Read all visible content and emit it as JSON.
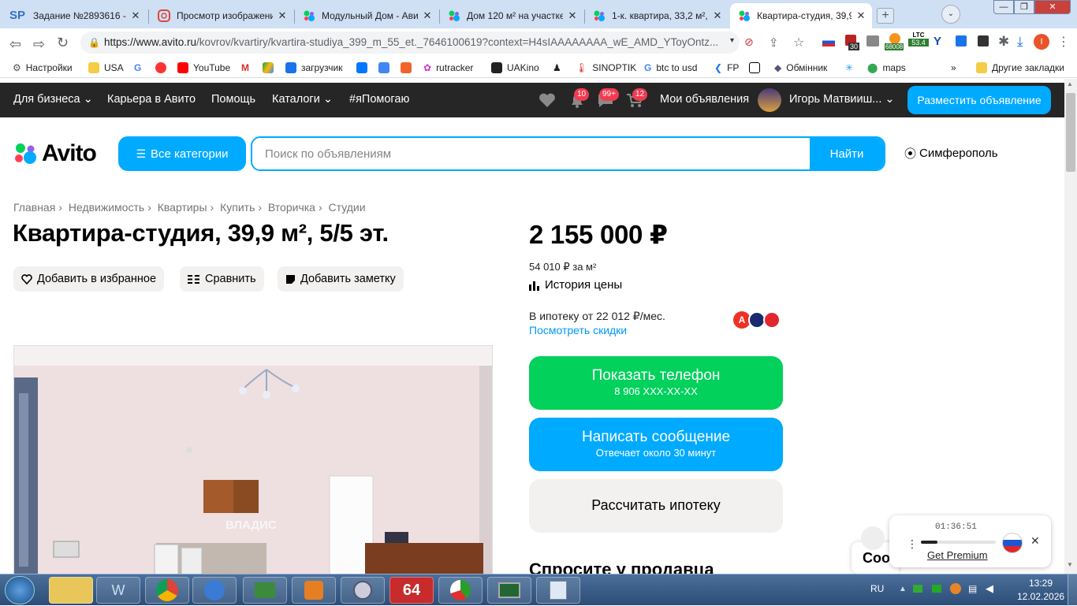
{
  "browser": {
    "tabs": [
      {
        "title": "Задание №2893616 - п",
        "favicon": "sp-icon"
      },
      {
        "title": "Просмотр изображени",
        "favicon": "image-viewer-icon"
      },
      {
        "title": "Модульный Дом - Ави",
        "favicon": "avito-icon"
      },
      {
        "title": "Дом 120 м² на участке",
        "favicon": "avito-icon"
      },
      {
        "title": "1-к. квартира, 33,2 м²,",
        "favicon": "avito-icon"
      },
      {
        "title": "Квартира-студия, 39,9",
        "favicon": "avito-icon"
      }
    ],
    "url_host": "https://www.avito.ru",
    "url_path": "/kovrov/kvartiry/kvartira-studiya_399_m_55_et._7646100619?context=H4sIAAAAAAAA_wE_AMD_YToyOntz...",
    "extensions": {
      "badge_30": "30",
      "btc_price": "68008",
      "ltc_label": "LTC",
      "ltc_price": "53.4",
      "profile_letter": "I"
    },
    "bookmarks": [
      "Настройки",
      "USA",
      "",
      "",
      "YouTube",
      "",
      "",
      "загрузчик",
      "",
      "",
      "",
      "rutracker",
      "UAKino",
      "",
      "SINOPTIK",
      "btc to usd",
      "FP",
      "",
      "Обмінник",
      "",
      "maps"
    ],
    "bookmarks_overflow": "»",
    "other_bookmarks": "Другие закладки"
  },
  "site": {
    "nav": {
      "business": "Для бизнеса",
      "career": "Карьера в Авито",
      "help": "Помощь",
      "catalogs": "Каталоги",
      "help_tag": "#яПомогаю",
      "notif_badge": "10",
      "messages_badge": "99+",
      "cart_badge": "12",
      "my_ads": "Мои объявления",
      "user_name": "Игорь Матвииш...",
      "post_ad": "Разместить объявление"
    },
    "logo_text": "Avito",
    "all_categories": "Все категории",
    "search_placeholder": "Поиск по объявлениям",
    "search_button": "Найти",
    "city": "Симферополь"
  },
  "listing": {
    "breadcrumbs": [
      "Главная",
      "Недвижимость",
      "Квартиры",
      "Купить",
      "Вторичка",
      "Студии"
    ],
    "title": "Квартира-студия, 39,9 м², 5/5 эт.",
    "actions": {
      "favorite": "Добавить в избранное",
      "compare": "Сравнить",
      "note": "Добавить заметку"
    },
    "price": "2 155 000 ₽",
    "price_per_m2": "54 010 ₽ за м²",
    "price_history": "История цены",
    "mortgage": "В ипотеку от 22 012 ₽/мес.",
    "discounts": "Посмотреть скидки",
    "show_phone": "Показать телефон",
    "phone_masked": "8 906 XXX-XX-XX",
    "write_message": "Написать сообщение",
    "reply_time": "Отвечает около 30 минут",
    "calc_mortgage": "Рассчитать ипотеку",
    "ask_seller": "Спросите у продавца",
    "photo_watermark": "ВЛАДИС"
  },
  "widget": {
    "timer": "01:36:51",
    "premium": "Get Premium",
    "chat_fragment": "Соо"
  },
  "taskbar": {
    "lang": "RU",
    "time": "13:29",
    "date": "12.02.2026",
    "app_64": "64"
  },
  "colors": {
    "avito_blue": "#00aaff",
    "avito_green": "#02d15c",
    "nav_dark": "#262626",
    "badge_red": "#f23b50"
  }
}
